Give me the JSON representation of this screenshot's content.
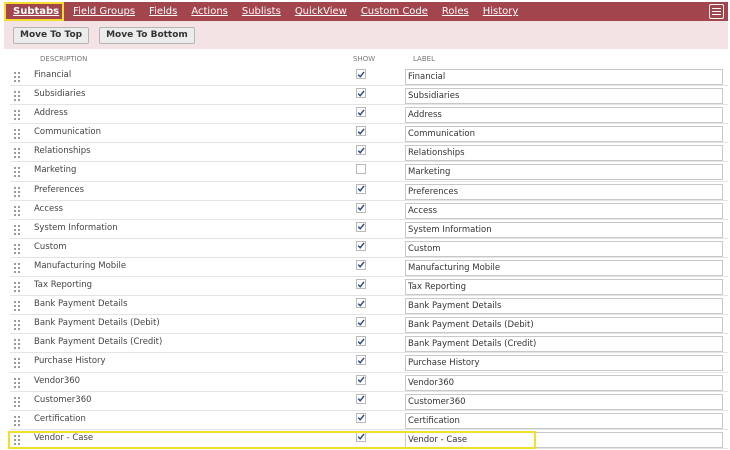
{
  "tabs": [
    {
      "label": "Subtabs",
      "active": true
    },
    {
      "label": "Field Groups"
    },
    {
      "label": "Fields"
    },
    {
      "label": "Actions"
    },
    {
      "label": "Sublists"
    },
    {
      "label": "QuickView"
    },
    {
      "label": "Custom Code"
    },
    {
      "label": "Roles"
    },
    {
      "label": "History"
    }
  ],
  "toolbar": {
    "move_top_label": "Move To Top",
    "move_bottom_label": "Move To Bottom"
  },
  "columns": {
    "description": "DESCRIPTION",
    "show": "SHOW",
    "label": "LABEL"
  },
  "rows": [
    {
      "description": "Financial",
      "show": true,
      "label": "Financial"
    },
    {
      "description": "Subsidiaries",
      "show": true,
      "label": "Subsidiaries"
    },
    {
      "description": "Address",
      "show": true,
      "label": "Address"
    },
    {
      "description": "Communication",
      "show": true,
      "label": "Communication"
    },
    {
      "description": "Relationships",
      "show": true,
      "label": "Relationships"
    },
    {
      "description": "Marketing",
      "show": false,
      "label": "Marketing"
    },
    {
      "description": "Preferences",
      "show": true,
      "label": "Preferences"
    },
    {
      "description": "Access",
      "show": true,
      "label": "Access"
    },
    {
      "description": "System Information",
      "show": true,
      "label": "System Information"
    },
    {
      "description": "Custom",
      "show": true,
      "label": "Custom"
    },
    {
      "description": "Manufacturing Mobile",
      "show": true,
      "label": "Manufacturing Mobile"
    },
    {
      "description": "Tax Reporting",
      "show": true,
      "label": "Tax Reporting"
    },
    {
      "description": "Bank Payment Details",
      "show": true,
      "label": "Bank Payment Details"
    },
    {
      "description": "Bank Payment Details (Debit)",
      "show": true,
      "label": "Bank Payment Details (Debit)"
    },
    {
      "description": "Bank Payment Details (Credit)",
      "show": true,
      "label": "Bank Payment Details (Credit)"
    },
    {
      "description": "Purchase History",
      "show": true,
      "label": "Purchase History"
    },
    {
      "description": "Vendor360",
      "show": true,
      "label": "Vendor360"
    },
    {
      "description": "Customer360",
      "show": true,
      "label": "Customer360"
    },
    {
      "description": "Certification",
      "show": true,
      "label": "Certification"
    },
    {
      "description": "Vendor - Case",
      "show": true,
      "label": "Vendor - Case"
    }
  ],
  "colors": {
    "tabbar": "#a3454c",
    "toolbar": "#f4e3e4",
    "highlight": "#f5dd2e",
    "check": "#2c4a86"
  },
  "icons": {
    "menu": "hamburger-menu-icon",
    "drag": "drag-handle-icon",
    "check": "checkmark-icon"
  }
}
